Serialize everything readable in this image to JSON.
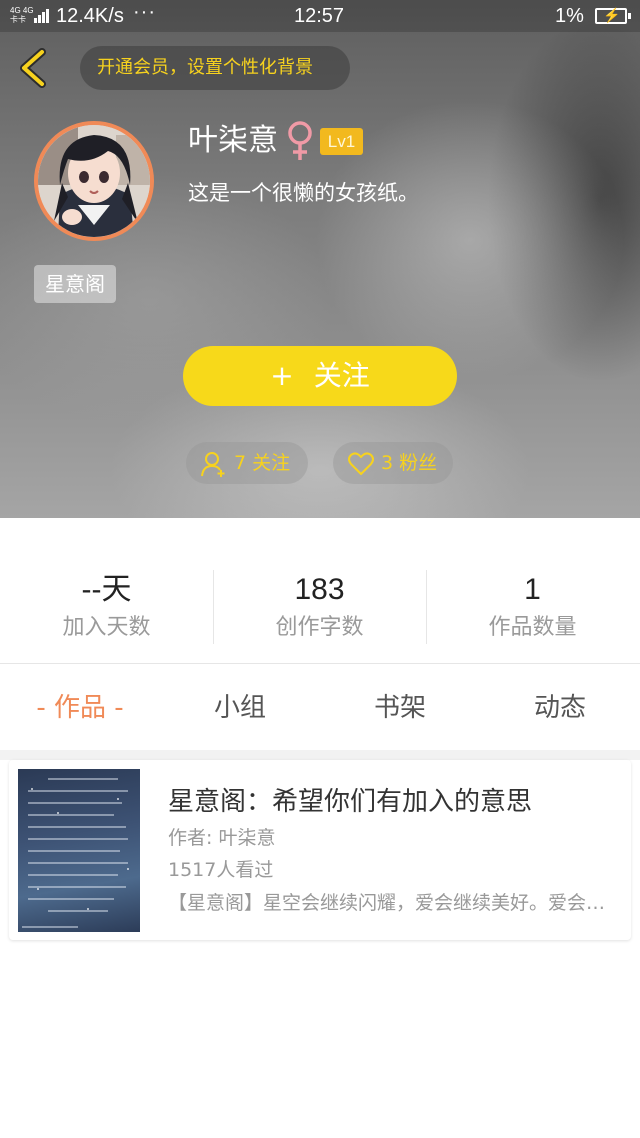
{
  "status_bar": {
    "network": "4G 4G",
    "carrier_small": "卡卡",
    "speed": "12.4K/s",
    "dots": "···",
    "time": "12:57",
    "battery": "1%"
  },
  "header": {
    "vip_prompt": "开通会员，设置个性化背景"
  },
  "profile": {
    "name": "叶柒意",
    "gender_icon": "female-symbol",
    "level": "Lv1",
    "bio": "这是一个很懒的女孩纸。",
    "group_badge": "星意阁",
    "follow_plus": "+",
    "follow_label": "关注",
    "following_text": "7 关注",
    "fans_text": "3 粉丝"
  },
  "stats": [
    {
      "value": "--天",
      "label": "加入天数"
    },
    {
      "value": "183",
      "label": "创作字数"
    },
    {
      "value": "1",
      "label": "作品数量"
    }
  ],
  "tabs": [
    {
      "label": "- 作品 -",
      "active": true
    },
    {
      "label": "小组",
      "active": false
    },
    {
      "label": "书架",
      "active": false
    },
    {
      "label": "动态",
      "active": false
    }
  ],
  "work": {
    "title": "星意阁：希望你们有加入的意思",
    "author": "作者: 叶柒意",
    "views": "1517人看过",
    "description": "【星意阁】星空会继续闪耀，爱会继续美好。爱会继续美好，星空会继续闪耀。"
  },
  "colors": {
    "accent_yellow": "#f7d91a",
    "accent_orange": "#f08a57",
    "level_badge": "#f2b91e",
    "gender_pink": "#f09aa6"
  }
}
